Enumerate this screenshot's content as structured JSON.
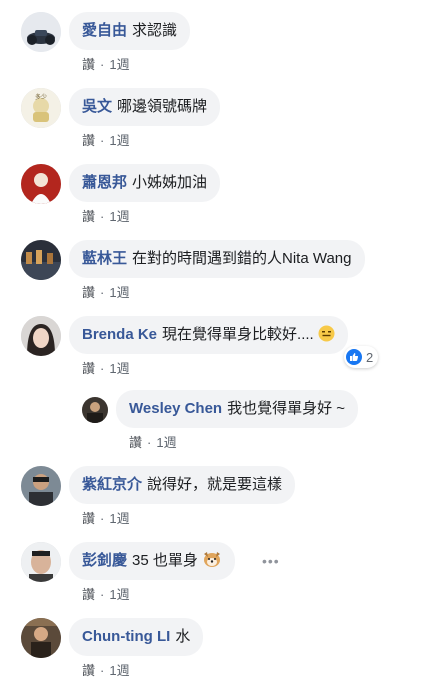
{
  "comments": [
    {
      "name": "愛自由",
      "text": "求認識",
      "like": "讚",
      "time": "1週"
    },
    {
      "name": "吳文",
      "text": "哪邊領號碼牌",
      "like": "讚",
      "time": "1週"
    },
    {
      "name": "蕭恩邦",
      "text": "小姊姊加油",
      "like": "讚",
      "time": "1週"
    },
    {
      "name": "藍林王",
      "text": "在對的時間遇到錯的人Nita Wang",
      "like": "讚",
      "time": "1週"
    },
    {
      "name": "Brenda Ke",
      "text": "現在覺得單身比較好....",
      "like": "讚",
      "time": "1週",
      "reaction_count": "2"
    },
    {
      "name": "Wesley Chen",
      "text": "我也覺得單身好 ~",
      "like": "讚",
      "time": "1週"
    },
    {
      "name": "紫紅京介",
      "text": "說得好，就是要這樣",
      "like": "讚",
      "time": "1週"
    },
    {
      "name": "彭釗慶",
      "text": "35 也單身",
      "like": "讚",
      "time": "1週",
      "more": "•••"
    },
    {
      "name": "Chun-ting LI",
      "text": "水",
      "like": "讚",
      "time": "1週"
    }
  ],
  "colors": {
    "name": "#385898",
    "bubble": "#f2f3f5",
    "meta": "#606770",
    "like_blue": "#1877f2"
  },
  "icons": [
    "thumbs-up-icon",
    "grinning-sweat-emoji",
    "dog-face-emoji",
    "more-options-icon"
  ]
}
